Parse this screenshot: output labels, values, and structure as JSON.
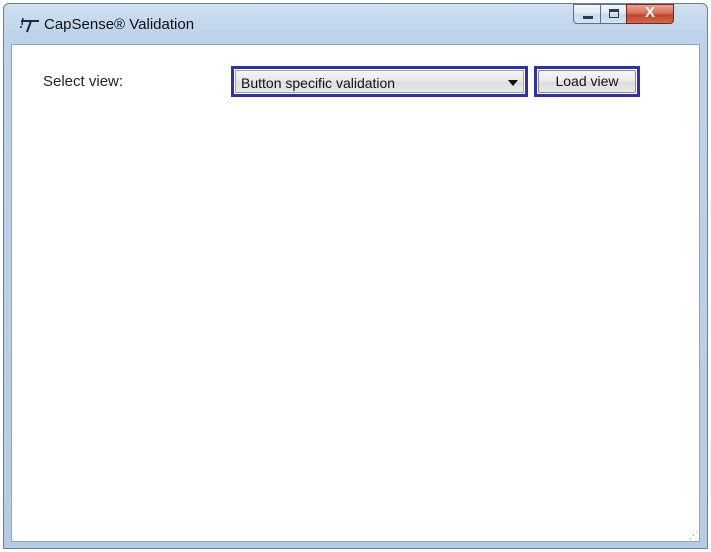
{
  "window": {
    "title": "CapSense® Validation",
    "controls": {
      "close_glyph": "X"
    }
  },
  "form": {
    "select_label": "Select view:",
    "view_select": {
      "selected": "Button specific validation"
    },
    "load_button_label": "Load view"
  },
  "icons": {
    "app": "capsense-app-icon",
    "minimize": "minimize-icon",
    "maximize": "maximize-icon",
    "close": "close-icon",
    "dropdown": "chevron-down-icon"
  },
  "colors": {
    "highlight_border": "#2e30b0",
    "close_button": "#c44527"
  }
}
